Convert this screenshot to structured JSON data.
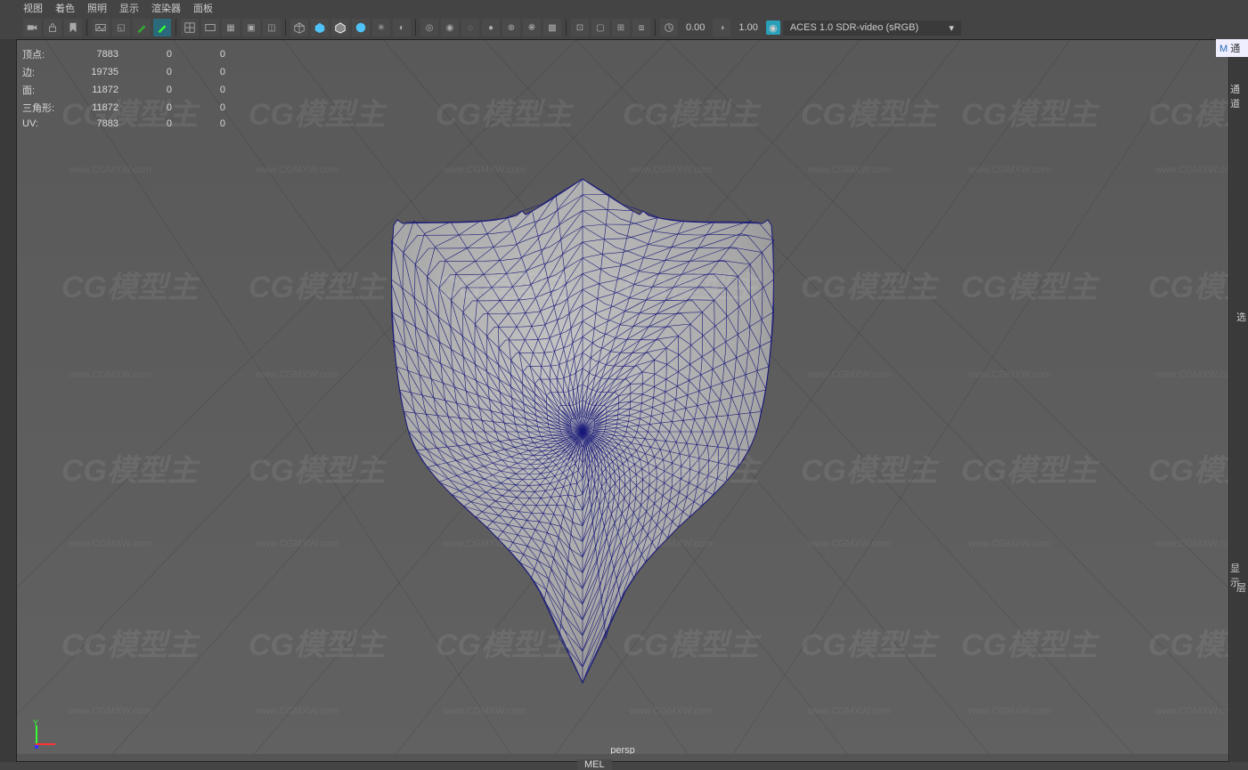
{
  "menus": {
    "m1": "视图",
    "m2": "着色",
    "m3": "照明",
    "m4": "显示",
    "m5": "渲染器",
    "m6": "面板"
  },
  "toolbar": {
    "value1": "0.00",
    "value2": "1.00",
    "colorspace": "ACES 1.0 SDR-video (sRGB)"
  },
  "hud": {
    "rows": [
      {
        "label": "顶点:",
        "v1": "7883",
        "v2": "0",
        "v3": "0"
      },
      {
        "label": "边:",
        "v1": "19735",
        "v2": "0",
        "v3": "0"
      },
      {
        "label": "面:",
        "v1": "11872",
        "v2": "0",
        "v3": "0"
      },
      {
        "label": "三角形:",
        "v1": "11872",
        "v2": "0",
        "v3": "0"
      },
      {
        "label": "UV:",
        "v1": "7883",
        "v2": "0",
        "v3": "0"
      }
    ]
  },
  "viewport": {
    "camera": "persp"
  },
  "right": {
    "tab1": "通",
    "label1": "通道",
    "label2": "选",
    "label3": "显示",
    "label4": "层"
  },
  "bottom": {
    "mel": "MEL"
  },
  "watermark": {
    "logo": "CG模型主",
    "url": "www.CGMXW.com"
  }
}
